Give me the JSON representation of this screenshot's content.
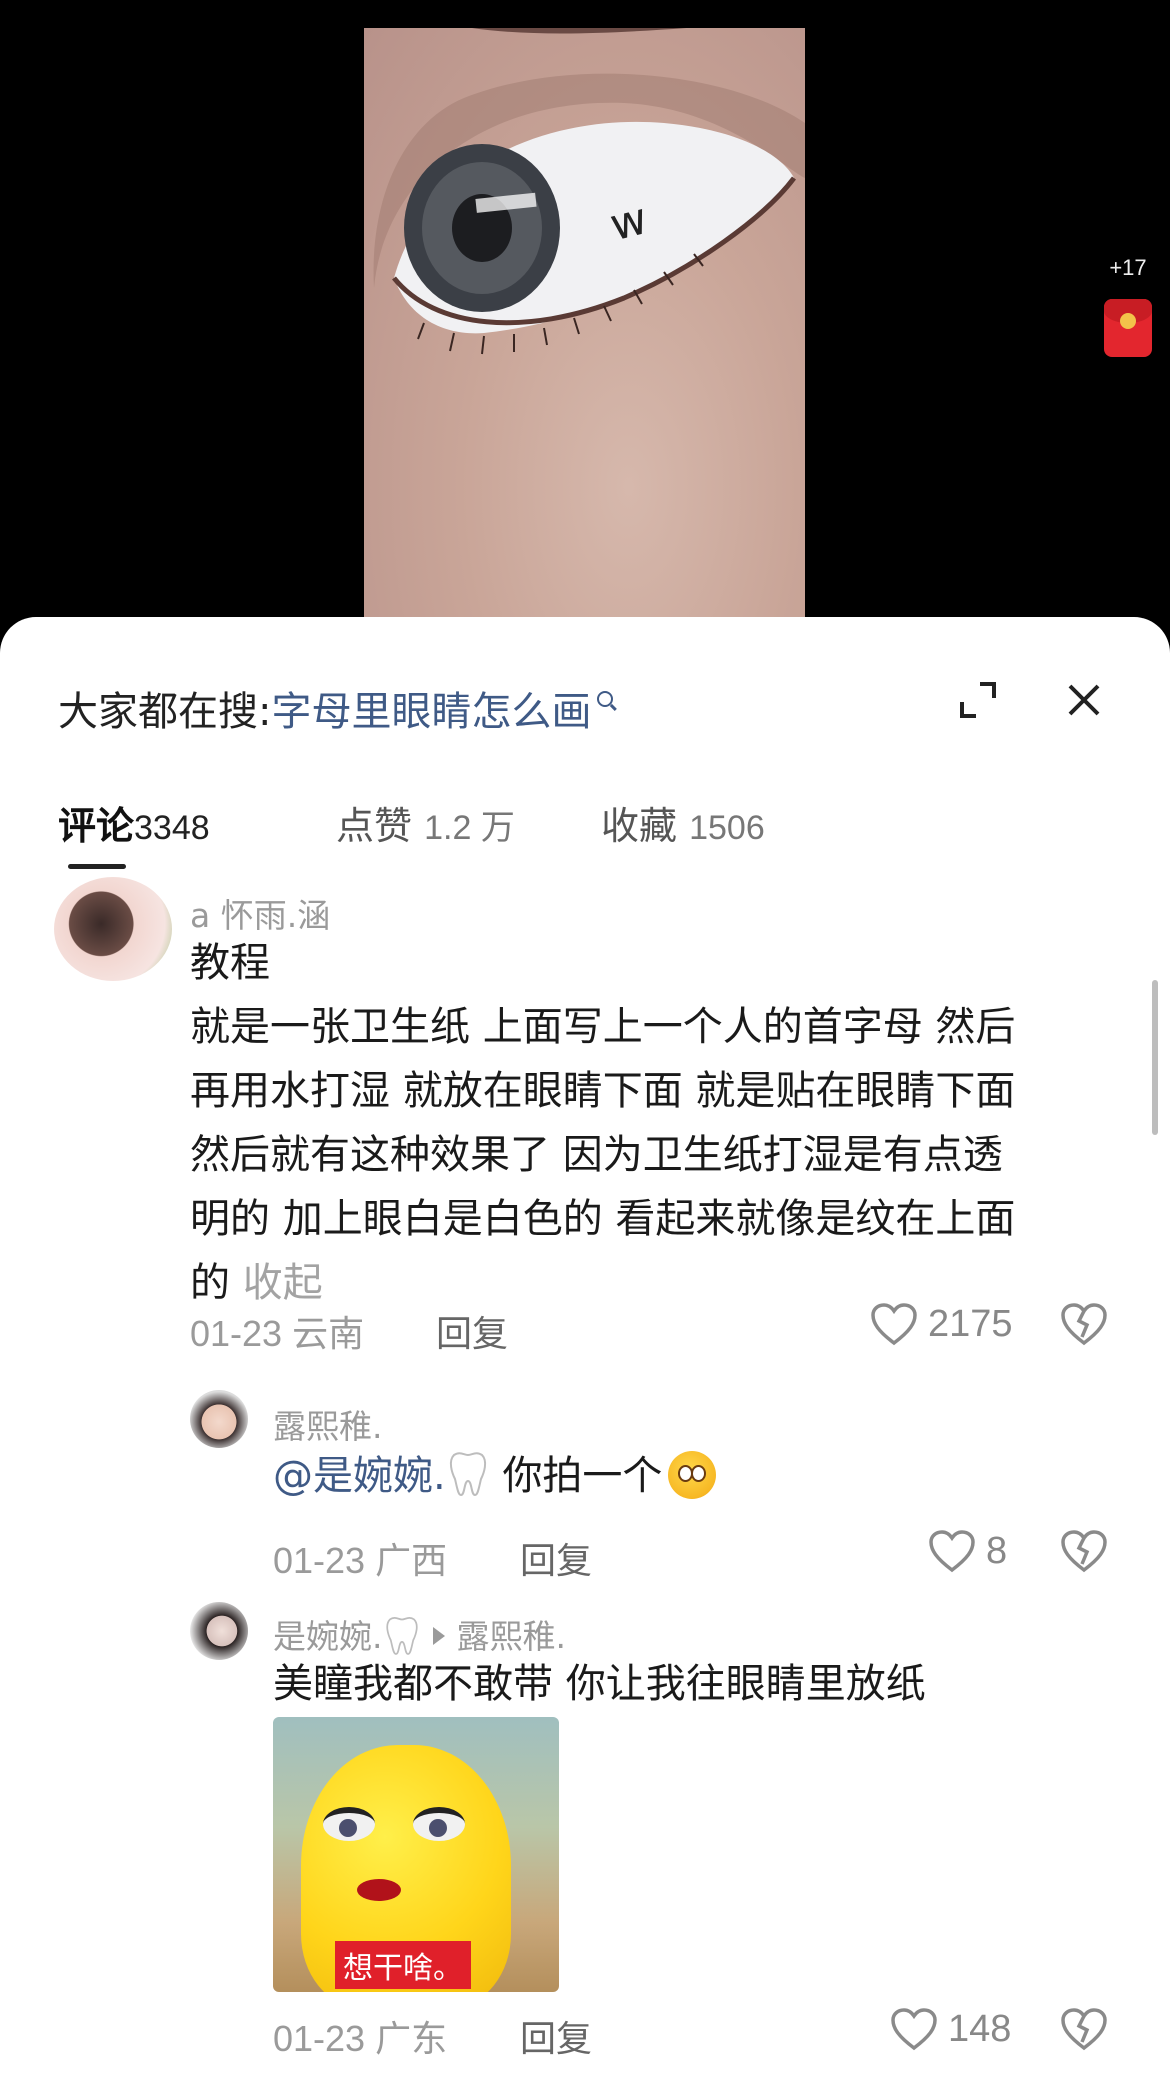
{
  "video": {
    "side_badge_count": "+17"
  },
  "search_hint": {
    "prefix": "大家都在搜:",
    "query": "字母里眼睛怎么画"
  },
  "tabs": [
    {
      "label": "评论",
      "count": "3348",
      "active": true
    },
    {
      "label": "点赞",
      "count": "1.2 万",
      "active": false
    },
    {
      "label": "收藏",
      "count": "1506",
      "active": false
    }
  ],
  "comments": [
    {
      "author": "a 怀雨.涵",
      "lines": [
        "教程",
        "就是一张卫生纸 上面写上一个人的首字母 然后",
        "再用水打湿 就放在眼睛下面 就是贴在眼睛下面",
        "然后就有这种效果了 因为卫生纸打湿是有点透",
        "明的 加上眼白是白色的 看起来就像是纹在上面",
        "的"
      ],
      "collapse_label": "收起",
      "date_location": "01-23 云南",
      "reply_label": "回复",
      "likes": "2175"
    },
    {
      "author": "露熙稚.",
      "mention": "@是婉婉.",
      "text": "你拍一个",
      "date_location": "01-23 广西",
      "reply_label": "回复",
      "likes": "8"
    },
    {
      "author": "是婉婉.",
      "reply_to": "露熙稚.",
      "text": "美瞳我都不敢带 你让我往眼睛里放纸",
      "sticker_caption": "想干啥。",
      "date_location": "01-23 广东",
      "reply_label": "回复",
      "likes": "148"
    }
  ],
  "icons": [
    "search-icon",
    "expand-icon",
    "close-icon",
    "heart-icon",
    "dislike-heart-icon",
    "tooth-icon",
    "flushed-face-emoji-icon",
    "red-envelope-icon"
  ]
}
